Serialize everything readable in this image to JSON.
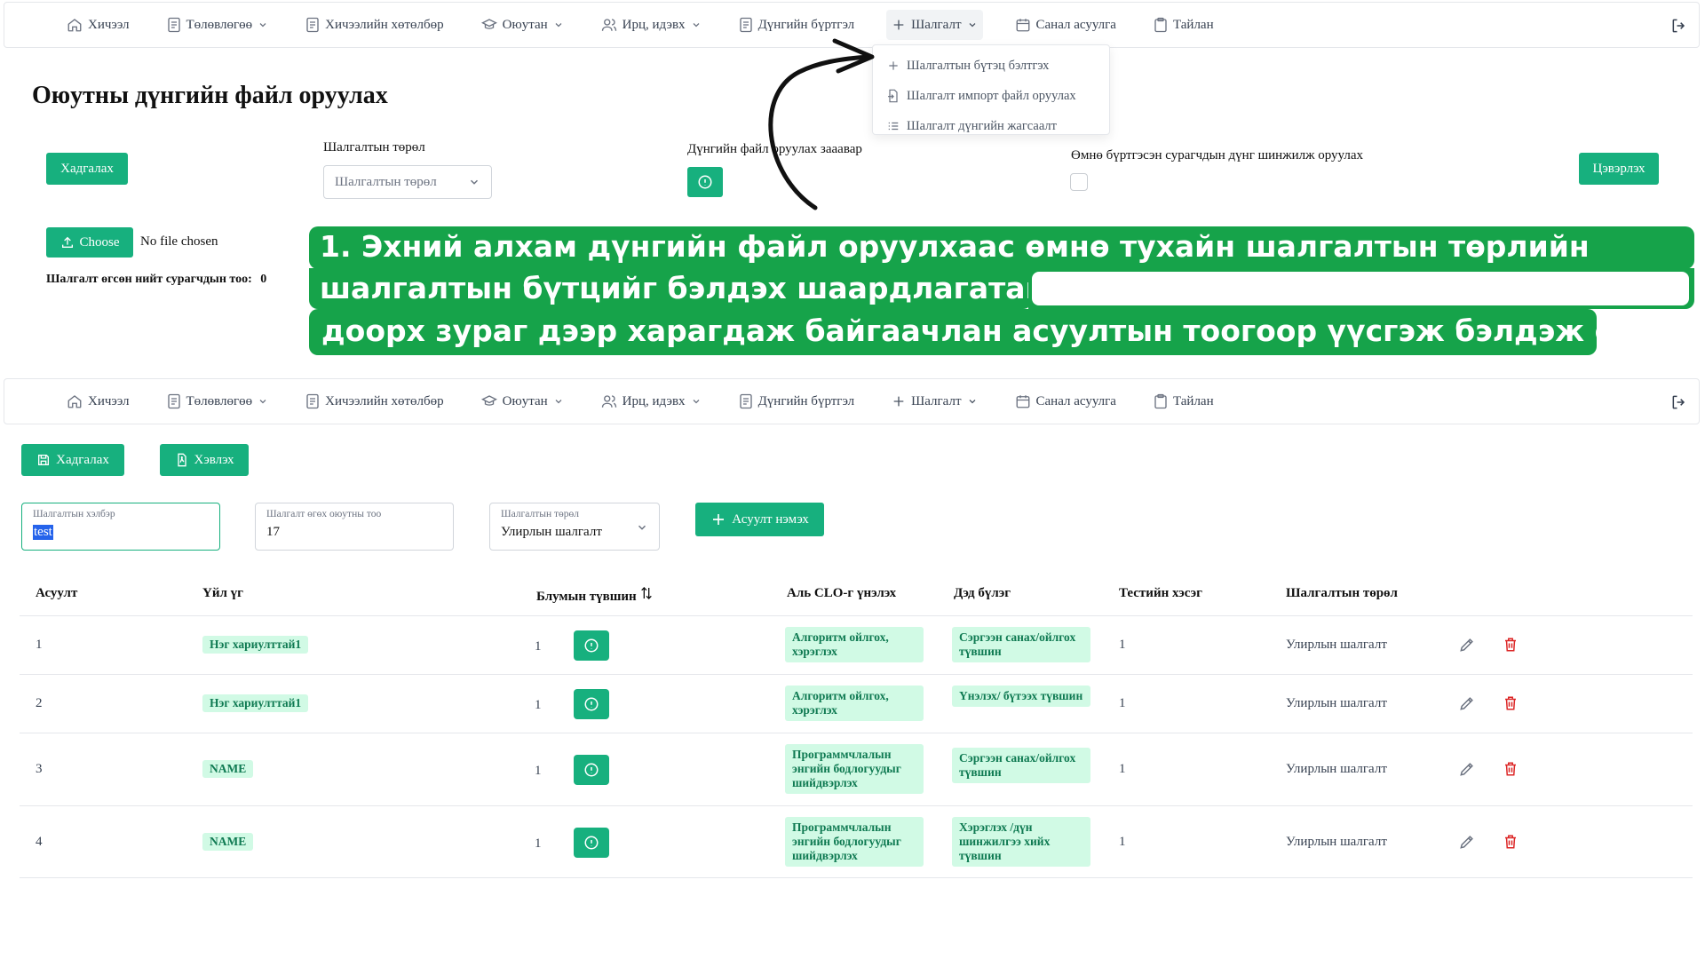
{
  "nav": {
    "items": [
      {
        "key": "home",
        "label": "Хичээл",
        "icon": "home-icon",
        "dropdown": false
      },
      {
        "key": "plan",
        "label": "Төлөвлөгөө",
        "icon": "document-icon",
        "dropdown": true
      },
      {
        "key": "program",
        "label": "Хичээлийн хөтөлбөр",
        "icon": "document-icon",
        "dropdown": false
      },
      {
        "key": "student",
        "label": "Оюутан",
        "icon": "graduation-cap-icon",
        "dropdown": true
      },
      {
        "key": "attendance",
        "label": "Ирц, идэвх",
        "icon": "users-icon",
        "dropdown": true
      },
      {
        "key": "grades",
        "label": "Дүнгийн бүртгэл",
        "icon": "document-icon",
        "dropdown": false
      },
      {
        "key": "exam",
        "label": "Шалгалт",
        "icon": "plus-icon",
        "dropdown": true
      },
      {
        "key": "survey",
        "label": "Санал асуулга",
        "icon": "calendar-icon",
        "dropdown": false
      },
      {
        "key": "report",
        "label": "Тайлан",
        "icon": "clipboard-icon",
        "dropdown": false
      }
    ],
    "exam_menu": [
      {
        "label": "Шалгалтын бүтэц бэлтгэх",
        "icon": "plus-icon"
      },
      {
        "label": "Шалгалт импорт файл оруулах",
        "icon": "file-import-icon"
      },
      {
        "label": "Шалгалт дүнгийн жагсаалт",
        "icon": "list-icon"
      }
    ]
  },
  "upload_page": {
    "title": "Оюутны дүнгийн файл оруулах",
    "save_label": "Хадгалах",
    "exam_type_label": "Шалгалтын төрөл",
    "exam_type_placeholder": "Шалгалтын төрөл",
    "instruction_label": "Дүнгийн файл оруулах зааавар",
    "prev_label": "Өмнө бүртгэсэн сурагчдын дүнг шинжилж оруулах",
    "clear_label": "Цэвэрлэх",
    "choose_label": "Choose",
    "no_file_label": "No file chosen",
    "count_label": "Шалгалт өгсөн нийт сурагчдын тоо:",
    "count_value": "0"
  },
  "instruction": {
    "line1": "1.  Эхний  алхам  дүнгийн  файл  оруулхаас  өмнө  тухайн  шалгалтын   төрлийн",
    "line2": "шалгалтын бүтцийг бэлдэх шаардлагатай.",
    "line3": " доорх зураг дээр харагдаж байгаачлан асуултын тоогоор үүсгэж бэлдэж өгнө."
  },
  "structure_page": {
    "save_label": "Хадгалах",
    "print_label": "Хэвлэх",
    "variant_label": "Шалгалтын хэлбэр",
    "variant_value": "test",
    "students_label": "Шалгалт өгөх оюутны тоо",
    "students_value": "17",
    "type_label": "Шалгалтын төрөл",
    "type_value": "Улирлын шалгалт",
    "add_question_label": "Асуулт нэмэх"
  },
  "table": {
    "headers": [
      "Асуулт",
      "Үйл үг",
      "Блумын түвшин",
      "Аль CLO-г үнэлэх",
      "Дэд бүлэг",
      "Тестийн хэсэг",
      "Шалгалтын төрөл"
    ],
    "rows": [
      {
        "q": "1",
        "verb": "Нэг хариулттай1",
        "bloom": "1",
        "clo": "Алгоритм ойлгох, хэрэглэх",
        "sub": "Сэргээн санах/ойлгох түвшин",
        "part": "1",
        "type": "Улирлын шалгалт"
      },
      {
        "q": "2",
        "verb": "Нэг хариулттай1",
        "bloom": "1",
        "clo": "Алгоритм ойлгох, хэрэглэх",
        "sub": "Үнэлэх/ бүтээх түвшин",
        "part": "1",
        "type": "Улирлын шалгалт"
      },
      {
        "q": "3",
        "verb": "NAME",
        "bloom": "1",
        "clo": "Программчлалын энгийн бодлогуудыг шийдвэрлэх",
        "sub": "Сэргээн санах/ойлгох түвшин",
        "part": "1",
        "type": "Улирлын шалгалт"
      },
      {
        "q": "4",
        "verb": "NAME",
        "bloom": "1",
        "clo": "Программчлалын энгийн бодлогуудыг шийдвэрлэх",
        "sub": "Хэрэглэх /дүн шинжилгээ хийх түвшин",
        "part": "1",
        "type": "Улирлын шалгалт"
      }
    ]
  },
  "colors": {
    "accent": "#17b07e",
    "instruction_bg": "#16a34a",
    "badge_bg": "#d1fae5",
    "delete": "#dc2626"
  }
}
